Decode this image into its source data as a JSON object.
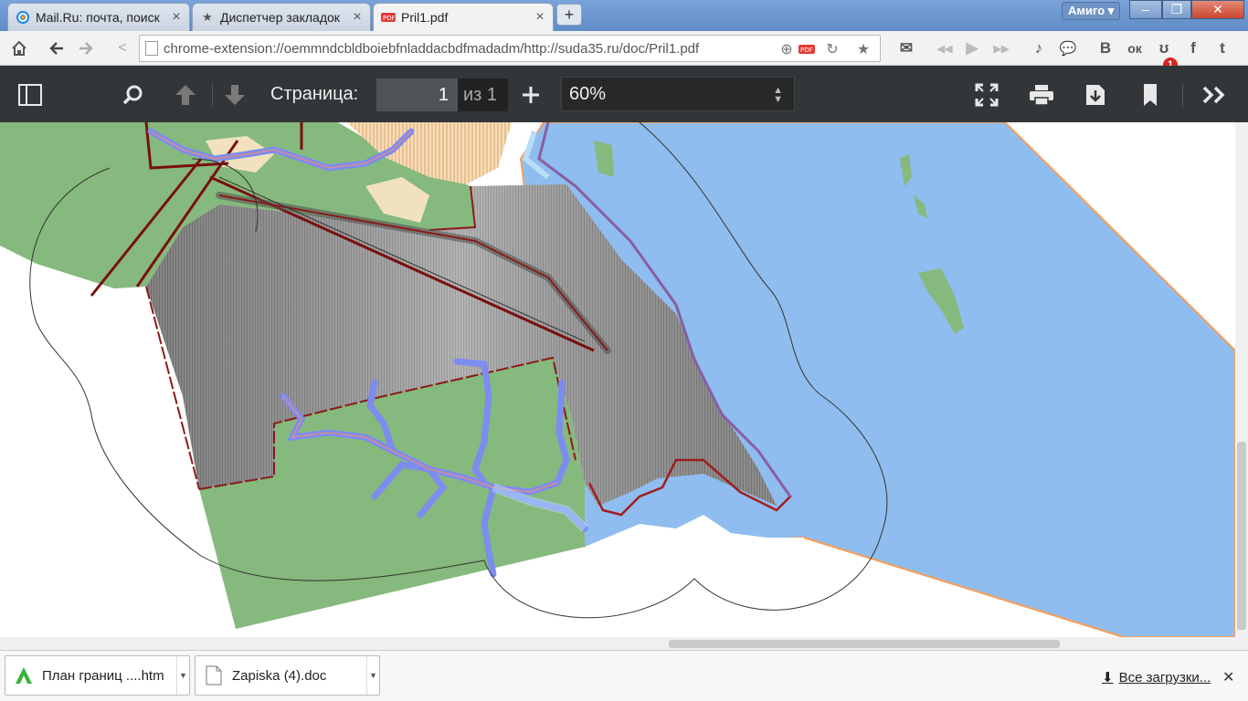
{
  "browser": {
    "tabs": [
      {
        "title": "Mail.Ru: почта, поиск",
        "icon": "mailru-icon"
      },
      {
        "title": "Диспетчер закладок",
        "icon": "star-icon"
      },
      {
        "title": "Pril1.pdf",
        "icon": "pdf-icon",
        "active": true
      }
    ],
    "new_tab_label": "+",
    "profile_label": "Амиго ▾",
    "url": "chrome-extension://oemmndcbldboiebfnladdacbdfmadadm/http://suda35.ru/doc/Pril1.pdf",
    "extensions": [
      {
        "name": "mail-icon",
        "glyph": "✉"
      },
      {
        "name": "media-prev-icon",
        "glyph": "◀◀"
      },
      {
        "name": "media-play-icon",
        "glyph": "▶"
      },
      {
        "name": "media-next-icon",
        "glyph": "▶▶"
      },
      {
        "name": "music-icon",
        "glyph": "♪"
      },
      {
        "name": "chat-icon",
        "glyph": "💬"
      },
      {
        "name": "vk-icon",
        "glyph": "В"
      },
      {
        "name": "odnoklassniki-icon",
        "glyph": "ок"
      },
      {
        "name": "moi-mir-icon",
        "glyph": "ʊ"
      },
      {
        "name": "facebook-icon",
        "glyph": "f"
      },
      {
        "name": "twitter-icon",
        "glyph": "t"
      }
    ],
    "notification_count": "1"
  },
  "pdf_viewer": {
    "page_label": "Страница:",
    "page_current": "1",
    "page_total": "из 1",
    "zoom": "60%"
  },
  "downloads": {
    "items": [
      {
        "name": "План границ ....htm",
        "icon": "amigo-icon"
      },
      {
        "name": "Zapiska (4).doc",
        "icon": "document-icon"
      }
    ],
    "all_label": "Все загрузки...",
    "close_label": "✕"
  },
  "colors": {
    "water": "#8fbdef",
    "forest": "#86b97d",
    "hatched_area": "#8a8a8a",
    "boundary": "#8b1a1a",
    "river": "#7d8cf0",
    "pdf_toolbar": "#323639"
  }
}
